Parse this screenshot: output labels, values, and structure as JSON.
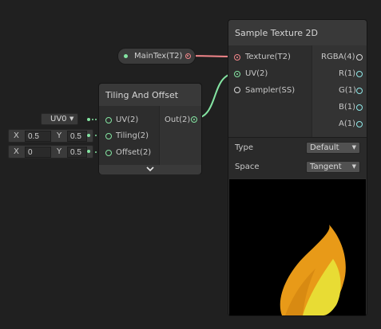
{
  "colors": {
    "background": "#202020",
    "vector_port": "#84e4a2",
    "texture_port": "#f2868a",
    "float_port": "#8fe8e8",
    "sampler_port": "#d8d8d8",
    "flame_outer": "#e89a18",
    "flame_inner": "#e8dc34"
  },
  "property_node": {
    "label": "MainTex(T2)"
  },
  "tiling_node": {
    "title": "Tiling And Offset",
    "inputs": [
      "UV(2)",
      "Tiling(2)",
      "Offset(2)"
    ],
    "output": "Out(2)",
    "expand_icon": "chevron-down-icon"
  },
  "inline_inputs": {
    "uv_channel": "UV0",
    "tiling": {
      "x_label": "X",
      "x": "0.5",
      "y_label": "Y",
      "y": "0.5"
    },
    "offset": {
      "x_label": "X",
      "x": "0",
      "y_label": "Y",
      "y": "0.5"
    }
  },
  "sample_node": {
    "title": "Sample Texture 2D",
    "inputs": [
      "Texture(T2)",
      "UV(2)",
      "Sampler(SS)"
    ],
    "outputs": [
      "RGBA(4)",
      "R(1)",
      "G(1)",
      "B(1)",
      "A(1)"
    ],
    "type_label": "Type",
    "type_value": "Default",
    "space_label": "Space",
    "space_value": "Tangent",
    "preview_content": "flame texture"
  }
}
